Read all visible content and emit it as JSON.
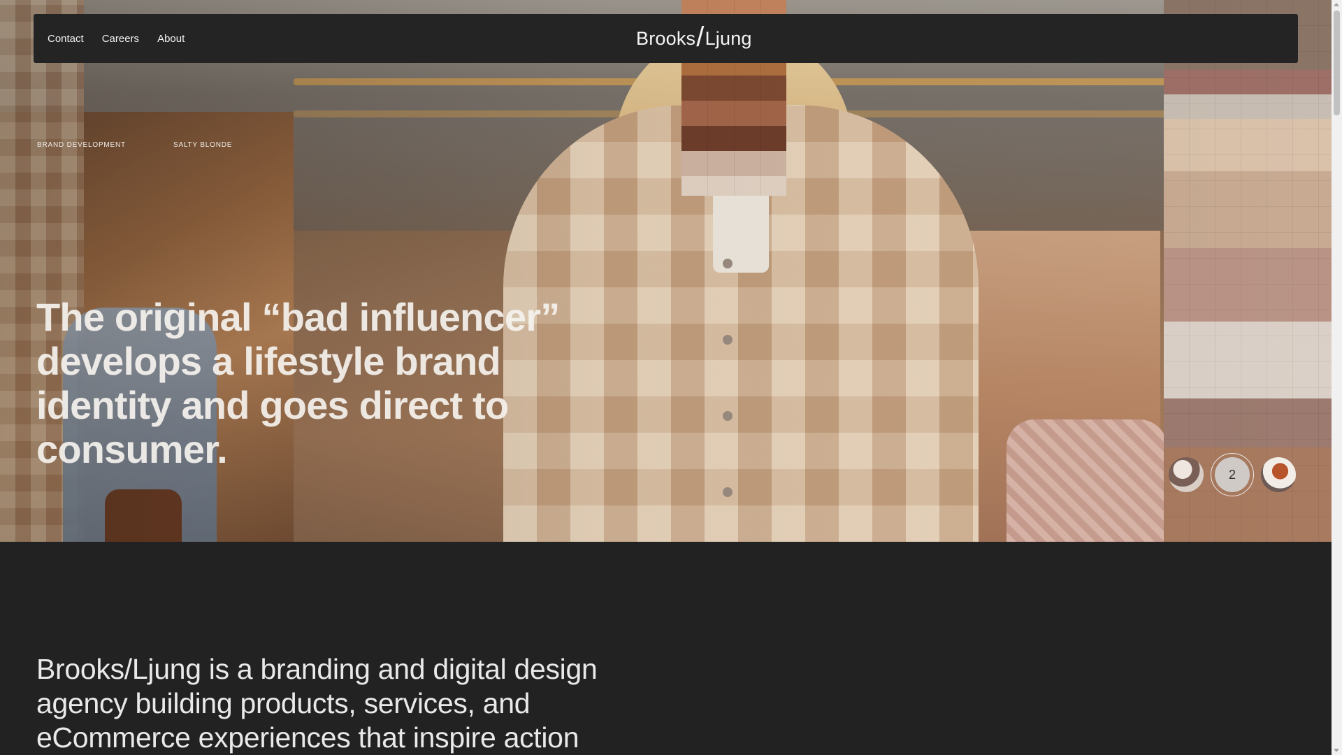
{
  "nav": {
    "links": [
      "Contact",
      "Careers",
      "About"
    ],
    "logo_left": "Brooks",
    "logo_slash": "/",
    "logo_right": "Ljung"
  },
  "hero": {
    "tags": [
      "BRAND DEVELOPMENT",
      "SALTY BLONDE"
    ],
    "title": "The original “bad influencer” develops a lifestyle brand identity and goes direct to consumer.",
    "slides": {
      "active_label": "2"
    }
  },
  "intro": {
    "text": "Brooks/Ljung is a branding and digital design agency building products, services, and eCommerce experiences that inspire action"
  },
  "colors": {
    "background": "#222222",
    "nav": "#242424",
    "text": "#f2f2f2"
  }
}
